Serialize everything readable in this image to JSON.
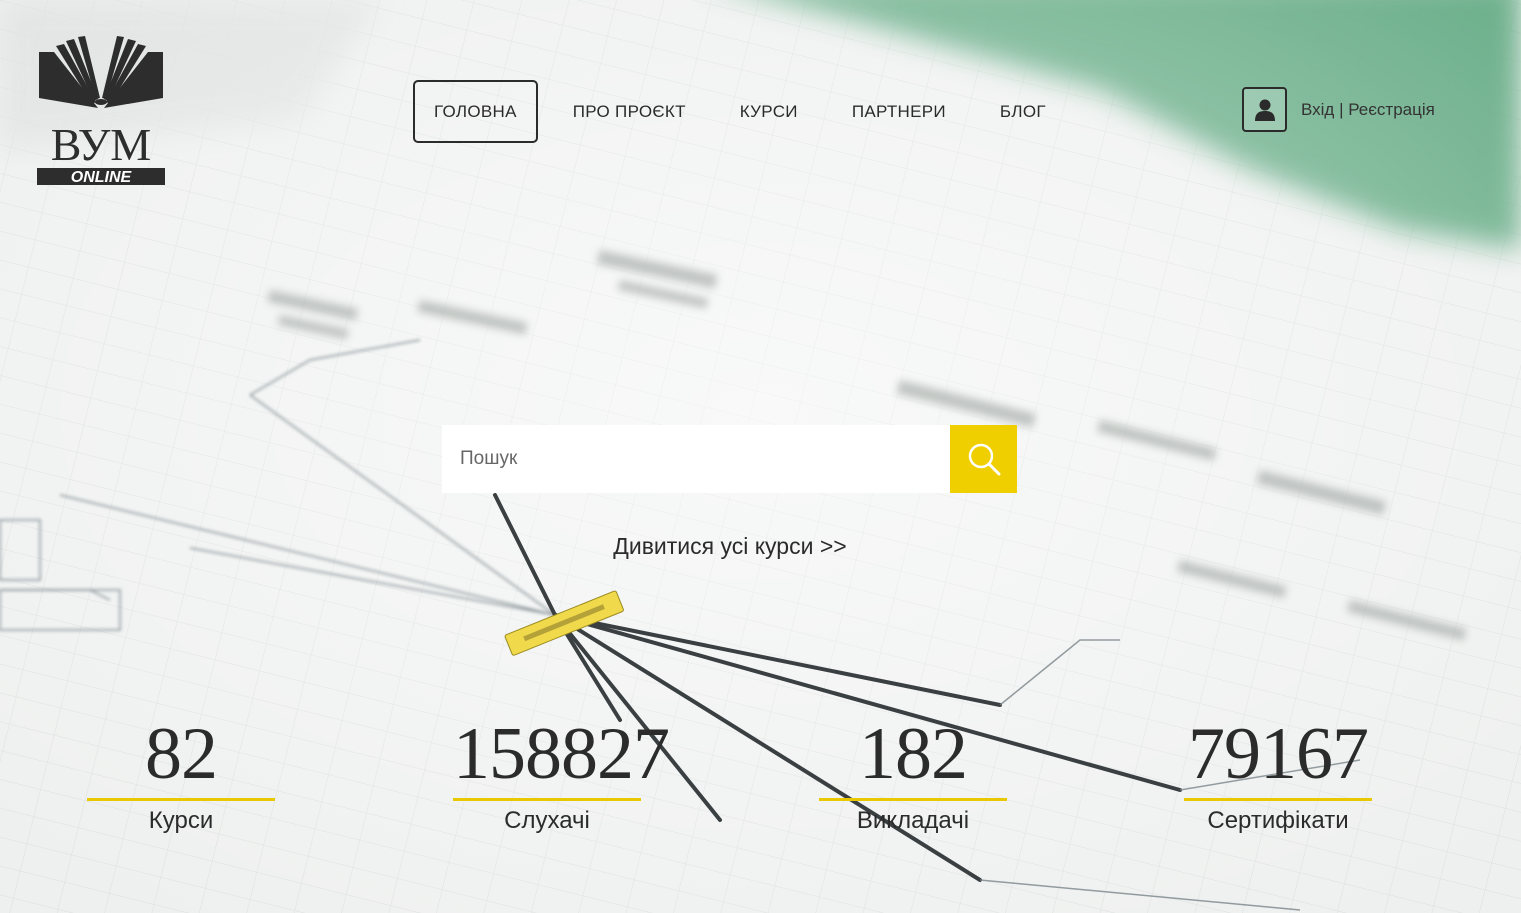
{
  "brand": {
    "logo_text": "ВУМ",
    "logo_subtext": "ONLINE"
  },
  "nav": {
    "items": [
      {
        "label": "ГОЛОВНА"
      },
      {
        "label": "ПРО ПРОЄКТ"
      },
      {
        "label": "КУРСИ"
      },
      {
        "label": "ПАРТНЕРИ"
      },
      {
        "label": "БЛОГ"
      }
    ]
  },
  "auth": {
    "label": "Вхід | Реєстрація",
    "icon": "user-icon"
  },
  "search": {
    "placeholder": "Пошук",
    "value": "",
    "icon": "search-icon"
  },
  "all_courses_link": "Дивитися усі курси >>",
  "stats": [
    {
      "value": "82",
      "label": "Курси"
    },
    {
      "value": "158827",
      "label": "Слухачі"
    },
    {
      "value": "182",
      "label": "Викладачі"
    },
    {
      "value": "79167",
      "label": "Сертифікати"
    }
  ],
  "colors": {
    "accent": "#f0cf00",
    "text": "#2b2b2b",
    "green": "#4f9e75"
  }
}
